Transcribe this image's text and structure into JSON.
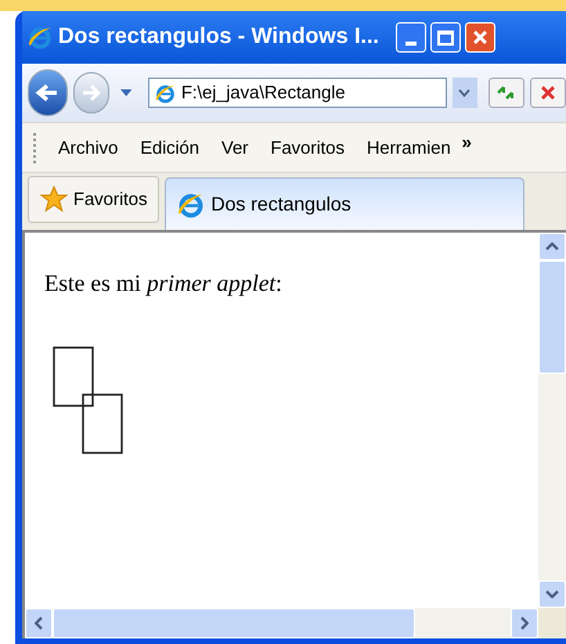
{
  "window": {
    "title": "Dos rectangulos - Windows I..."
  },
  "address_bar": {
    "value": "F:\\ej_java\\Rectangle"
  },
  "menu": {
    "items": [
      "Archivo",
      "Edición",
      "Ver",
      "Favoritos",
      "Herramien"
    ],
    "overflow": "»"
  },
  "favorites_button": {
    "label": "Favoritos"
  },
  "tabs": [
    {
      "label": "Dos rectangulos",
      "selected": true
    }
  ],
  "page": {
    "text": "Este es mi *primer applet*:"
  }
}
